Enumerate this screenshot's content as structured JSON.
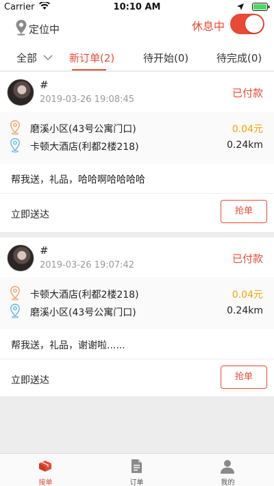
{
  "status_bar": {
    "carrier": "Carrier",
    "time": "10:10 AM"
  },
  "header": {
    "location_label": "定位中",
    "rest_status": "休息中",
    "work_toggle_on": true
  },
  "tabs": [
    {
      "label": "全部",
      "active": false
    },
    {
      "label": "新订单(2)",
      "active": true
    },
    {
      "label": "待开始(0)",
      "active": false
    },
    {
      "label": "待完成(0)",
      "active": false
    }
  ],
  "orders": [
    {
      "number": "#",
      "timestamp": "2019-03-26 19:08:45",
      "status": "已付款",
      "from_address": "磨溪小区(43号公寓门口)",
      "price": "0.04元",
      "to_address": "卡顿大酒店(利都2楼218)",
      "distance": "0.24km",
      "note": "帮我送，礼品，哈哈啊哈哈哈哈",
      "delivery_type": "立即送达",
      "grab_label": "抢单"
    },
    {
      "number": "#",
      "timestamp": "2019-03-26 19:07:42",
      "status": "已付款",
      "from_address": "卡顿大酒店(利都2楼218)",
      "price": "0.04元",
      "to_address": "磨溪小区(43号公寓门口)",
      "distance": "0.24km",
      "note": "帮我送，礼品，谢谢啦......",
      "delivery_type": "立即送达",
      "grab_label": "抢单"
    }
  ],
  "tab_bar": [
    {
      "label": "接单",
      "icon": "grab-orders-icon",
      "active": true
    },
    {
      "label": "订单",
      "icon": "document-icon",
      "active": false
    },
    {
      "label": "我的",
      "icon": "profile-icon",
      "active": false
    }
  ],
  "colors": {
    "accent": "#e84a35",
    "price": "#f0a400",
    "pickup_marker": "#f0a060",
    "dropoff_marker": "#5bb8e0"
  }
}
